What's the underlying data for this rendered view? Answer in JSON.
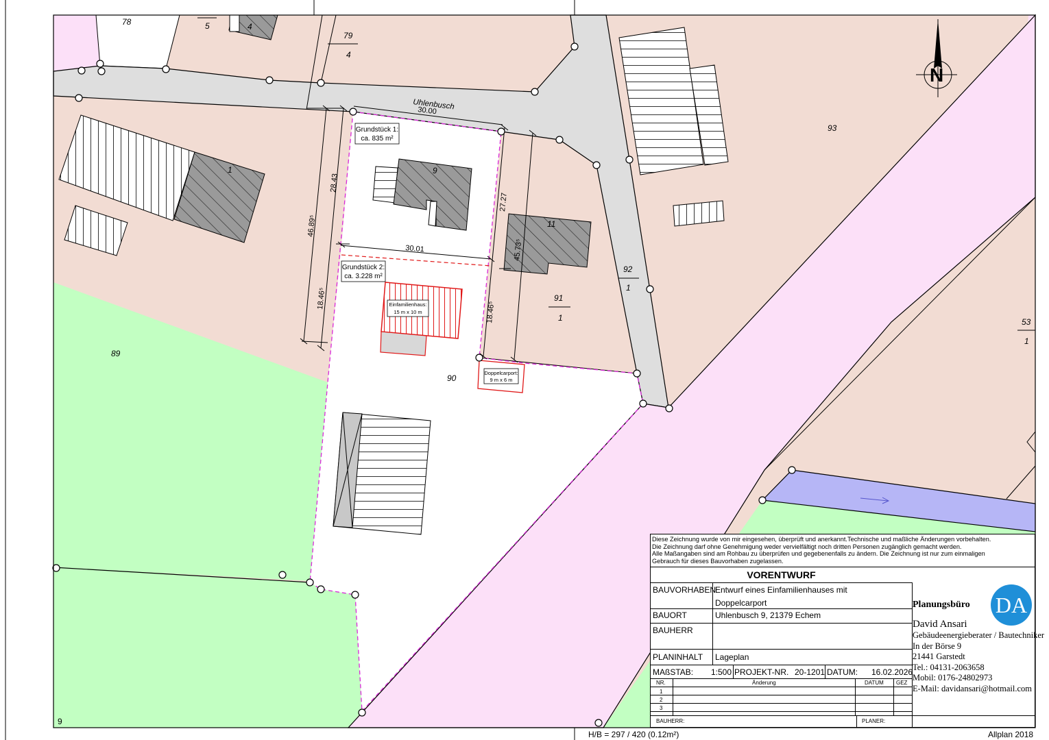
{
  "parcels": {
    "p78": "78",
    "p5": "5",
    "p4a": "4",
    "p79": "79",
    "p79_sub": "4",
    "p93": "93",
    "p1": "1",
    "p9": "9",
    "p11": "11",
    "p92": "92",
    "p92_sub": "1",
    "p91": "91",
    "p91_sub": "1",
    "p53": "53",
    "p53_sub": "1",
    "p89": "89",
    "p90": "90",
    "p9_bottom": "9"
  },
  "street": "Uhlenbusch",
  "compass": "N",
  "dimensions": {
    "top_width": "30.00",
    "mid_width": "30.01",
    "left_total": "46.89⁵",
    "left_upper": "28.43",
    "left_lower": "18.46⁵",
    "right_upper": "27.27",
    "right_total": "45.73⁵",
    "right_lower": "18.46⁵"
  },
  "plot1": {
    "line1": "Grundstück 1:",
    "line2": "ca. 835 m²"
  },
  "plot2": {
    "line1": "Grundstück 2:",
    "line2": "ca. 3.228 m²"
  },
  "house": {
    "line1": "Einfamilienhaus:",
    "line2": "15 m x 10 m"
  },
  "carport": {
    "line1": "Doppelcarport:",
    "line2": "9 m x 6 m"
  },
  "title_block": {
    "notice": [
      "Diese Zeichnung wurde von mir eingesehen, überprüft und anerkannt.Technische und maßliche Änderungen vorbehalten.",
      "Die Zeichnung darf ohne Genehmigung weder vervielfältigt noch dritten Personen zugänglich gemacht werden.",
      "Alle Maßangaben sind am Rohbau zu überprüfen und gegebenenfalls zu ändern. Die Zeichnung ist nur zum einmaligen",
      "Gebrauch für dieses Bauvorhaben zugelassen."
    ],
    "title": "VORENTWURF",
    "bauvorhaben_label": "BAUVORHABEN",
    "bauvorhaben_line1": "Entwurf eines Einfamilienhauses mit",
    "bauvorhaben_line2": "Doppelcarport",
    "bauort_label": "BAUORT",
    "bauort_value": "Uhlenbusch 9, 21379 Echem",
    "bauherr_label": "BAUHERR",
    "bauherr_value": "",
    "planinhalt_label": "PLANINHALT",
    "planinhalt_value": "Lageplan",
    "massstab_label": "MAßSTAB:",
    "massstab_value": "1:500",
    "projekt_label": "PROJEKT-NR.",
    "projekt_value": "20-1201",
    "datum_label": "DATUM:",
    "datum_value": "16.02.2026",
    "rev_headers": {
      "nr": "NR.",
      "aenderung": "Änderung",
      "datum": "DATUM",
      "gez": "GEZ"
    },
    "rev_rows": [
      "1",
      "2",
      "3"
    ],
    "footer_bauherr": "BAUHERR:",
    "footer_planer": "PLANER:"
  },
  "firm": {
    "heading": "Planungsbüro",
    "logo": "DA",
    "name": "David Ansari",
    "role": "Gebäudeenergieberater / Bautechniker",
    "street": "In der Börse 9",
    "city": "21441 Garstedt",
    "tel": "Tel.: 04131-2063658",
    "mobil": "Mobil: 0176-24802973",
    "email": "E-Mail: davidansari@hotmail.com"
  },
  "footer": {
    "format": "H/B = 297 / 420 (0.12m²)",
    "software": "Allplan 2018"
  },
  "colors": {
    "residential": "#f2dcd3",
    "road": "#dedede",
    "path": "#fce0f8",
    "green": "#c2ffc2",
    "water": "#b6b6f6",
    "boundary": "#d928d9",
    "planned": "#e01818"
  }
}
